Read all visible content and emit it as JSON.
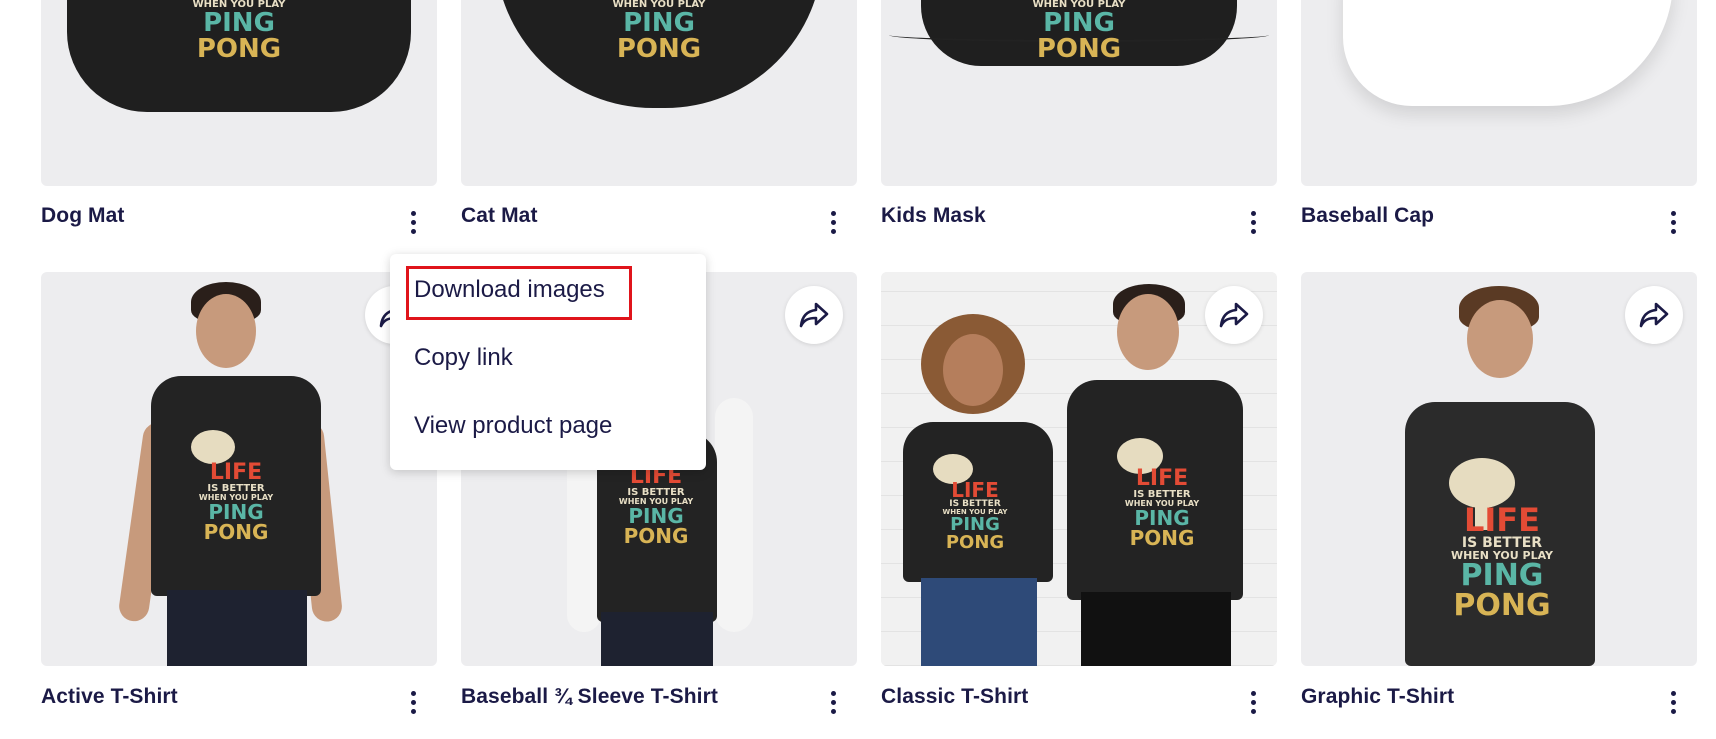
{
  "products_row1": [
    {
      "title": "Dog Mat"
    },
    {
      "title": "Cat Mat"
    },
    {
      "title": "Kids Mask"
    },
    {
      "title": "Baseball Cap"
    }
  ],
  "products_row2": [
    {
      "title": "Active T-Shirt"
    },
    {
      "title": "Baseball ¾ Sleeve T-Shirt"
    },
    {
      "title": "Classic T-Shirt"
    },
    {
      "title": "Graphic T-Shirt"
    }
  ],
  "design": {
    "life": "LIFE",
    "is_better": "IS BETTER",
    "when_you_play": "WHEN YOU PLAY",
    "ping": "PING",
    "pong": "PONG"
  },
  "menu": {
    "items": [
      "Download images",
      "Copy link",
      "View product page"
    ],
    "highlighted": "Download images"
  },
  "icons": {
    "share": "share-arrow-icon",
    "more": "more-vertical-icon"
  },
  "colors": {
    "text": "#1b1a46",
    "highlight_border": "#e0141b",
    "menu_bg": "#ffffff"
  }
}
